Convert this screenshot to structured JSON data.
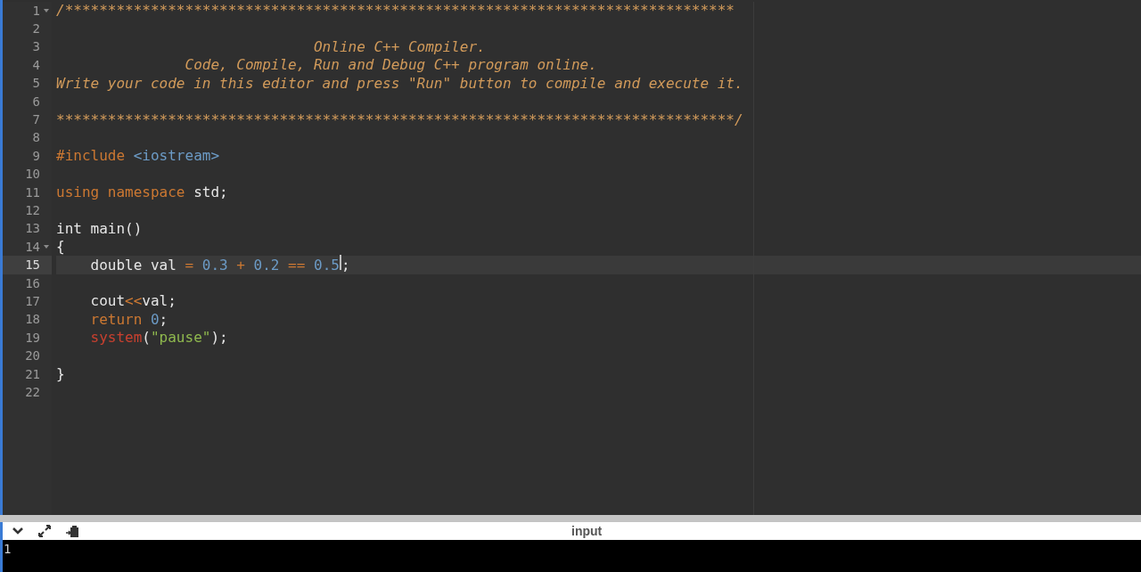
{
  "editor": {
    "lines": [
      {
        "number": "1",
        "foldable": true,
        "active": false,
        "tokens": [
          {
            "kind": "comment",
            "text": "/******************************************************************************"
          }
        ]
      },
      {
        "number": "2",
        "foldable": false,
        "active": false
      },
      {
        "number": "3",
        "foldable": false,
        "active": false,
        "tokens": [
          {
            "kind": "comment",
            "text": "                              Online C++ Compiler."
          }
        ]
      },
      {
        "number": "4",
        "foldable": false,
        "active": false,
        "tokens": [
          {
            "kind": "comment",
            "text": "               Code, Compile, Run and Debug C++ program online."
          }
        ]
      },
      {
        "number": "5",
        "foldable": false,
        "active": false,
        "tokens": [
          {
            "kind": "comment",
            "text": "Write your code in this editor and press \"Run\" button to compile and execute it."
          }
        ]
      },
      {
        "number": "6",
        "foldable": false,
        "active": false
      },
      {
        "number": "7",
        "foldable": false,
        "active": false,
        "tokens": [
          {
            "kind": "comment",
            "text": "*******************************************************************************/"
          }
        ]
      },
      {
        "number": "8",
        "foldable": false,
        "active": false
      },
      {
        "number": "9",
        "foldable": false,
        "active": false,
        "tokens": [
          {
            "kind": "keyword",
            "text": "#include "
          },
          {
            "kind": "number",
            "text": "<iostream>"
          }
        ]
      },
      {
        "number": "10",
        "foldable": false,
        "active": false
      },
      {
        "number": "11",
        "foldable": false,
        "active": false,
        "tokens": [
          {
            "kind": "keyword",
            "text": "using namespace"
          },
          {
            "kind": "plain",
            "text": " std;"
          }
        ]
      },
      {
        "number": "12",
        "foldable": false,
        "active": false
      },
      {
        "number": "13",
        "foldable": false,
        "active": false,
        "tokens": [
          {
            "kind": "plain",
            "text": "int main()"
          }
        ]
      },
      {
        "number": "14",
        "foldable": true,
        "active": false,
        "tokens": [
          {
            "kind": "plain",
            "text": "{"
          }
        ]
      },
      {
        "number": "15",
        "foldable": false,
        "active": true,
        "tokens": [
          {
            "kind": "plain",
            "text": "    double val "
          },
          {
            "kind": "keyword",
            "text": "= "
          },
          {
            "kind": "number",
            "text": "0.3 "
          },
          {
            "kind": "keyword",
            "text": "+ "
          },
          {
            "kind": "number",
            "text": "0.2 "
          },
          {
            "kind": "keyword",
            "text": "== "
          },
          {
            "kind": "number",
            "text": "0.5",
            "cursor": true
          },
          {
            "kind": "plain",
            "text": ";"
          }
        ]
      },
      {
        "number": "16",
        "foldable": false,
        "active": false
      },
      {
        "number": "17",
        "foldable": false,
        "active": false,
        "tokens": [
          {
            "kind": "plain",
            "text": "    cout"
          },
          {
            "kind": "keyword",
            "text": "<<"
          },
          {
            "kind": "plain",
            "text": "val;"
          }
        ]
      },
      {
        "number": "18",
        "foldable": false,
        "active": false,
        "tokens": [
          {
            "kind": "keyword",
            "text": "    return "
          },
          {
            "kind": "number",
            "text": "0"
          },
          {
            "kind": "plain",
            "text": ";"
          }
        ]
      },
      {
        "number": "19",
        "foldable": false,
        "active": false,
        "tokens": [
          {
            "kind": "builtin",
            "text": "    system"
          },
          {
            "kind": "plain",
            "text": "("
          },
          {
            "kind": "string",
            "text": "\"pause\""
          },
          {
            "kind": "plain",
            "text": ");"
          }
        ]
      },
      {
        "number": "20",
        "foldable": false,
        "active": false
      },
      {
        "number": "21",
        "foldable": false,
        "active": false,
        "tokens": [
          {
            "kind": "plain",
            "text": "}"
          }
        ]
      },
      {
        "number": "22",
        "foldable": false,
        "active": false
      }
    ]
  },
  "io_panel": {
    "label": "input",
    "output": "1"
  }
}
